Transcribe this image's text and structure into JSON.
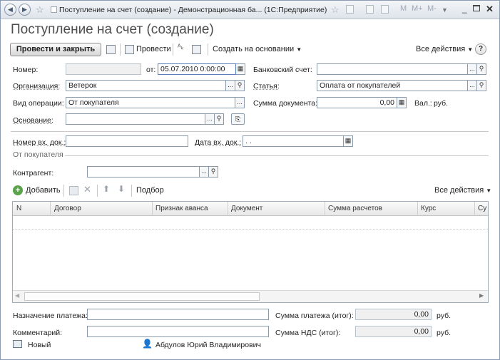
{
  "window": {
    "title": "Поступление на счет (создание) - Демонстрационная ба... (1С:Предприятие)",
    "toolbar_icons": [
      "star-icon",
      "calculator-icon",
      "calendar-icon",
      "memory-m",
      "memory-mplus",
      "memory-mminus"
    ],
    "memory_labels": [
      "M",
      "M+",
      "M-"
    ]
  },
  "form": {
    "heading": "Поступление на счет (создание)",
    "toolbar": {
      "post_close": "Провести и закрыть",
      "post": "Провести",
      "create_based": "Создать на основании",
      "all_actions": "Все действия",
      "help": "?"
    },
    "fields": {
      "number_label": "Номер:",
      "number_value": "",
      "from_label": "от:",
      "date_value": "05.07.2010  0:00:00",
      "bank_account_label": "Банковский счет:",
      "bank_account_value": "",
      "org_label": "Организация:",
      "org_value": "Ветерок",
      "article_label": "Статья:",
      "article_value": "Оплата от покупателей",
      "op_type_label": "Вид операции:",
      "op_type_value": "От покупателя",
      "doc_sum_label": "Сумма документа:",
      "doc_sum_value": "0,00",
      "currency_label": "Вал.:",
      "currency_value": "руб.",
      "basis_label": "Основание:",
      "basis_value": "",
      "in_doc_num_label": "Номер вх. док.:",
      "in_doc_num_value": "",
      "in_doc_date_label": "Дата вх. док.:",
      "in_doc_date_value": " .  .",
      "from_buyer_group": "От покупателя",
      "counterparty_label": "Контрагент:",
      "counterparty_value": ""
    },
    "table": {
      "add": "Добавить",
      "selection": "Подбор",
      "all_actions": "Все действия",
      "columns": [
        "N",
        "Договор",
        "Признак аванса",
        "Документ",
        "Сумма расчетов",
        "Курс",
        "Су"
      ]
    },
    "bottom": {
      "purpose_label": "Назначение платежа:",
      "purpose_value": "",
      "payment_total_label": "Сумма платежа (итог):",
      "payment_total_value": "0,00",
      "payment_total_unit": "руб.",
      "comment_label": "Комментарий:",
      "comment_value": "",
      "vat_label": "Сумма НДС (итог):",
      "vat_value": "0,00",
      "vat_unit": "руб."
    },
    "status": {
      "state": "Новый",
      "user": "Абдулов Юрий Владимирович"
    }
  }
}
